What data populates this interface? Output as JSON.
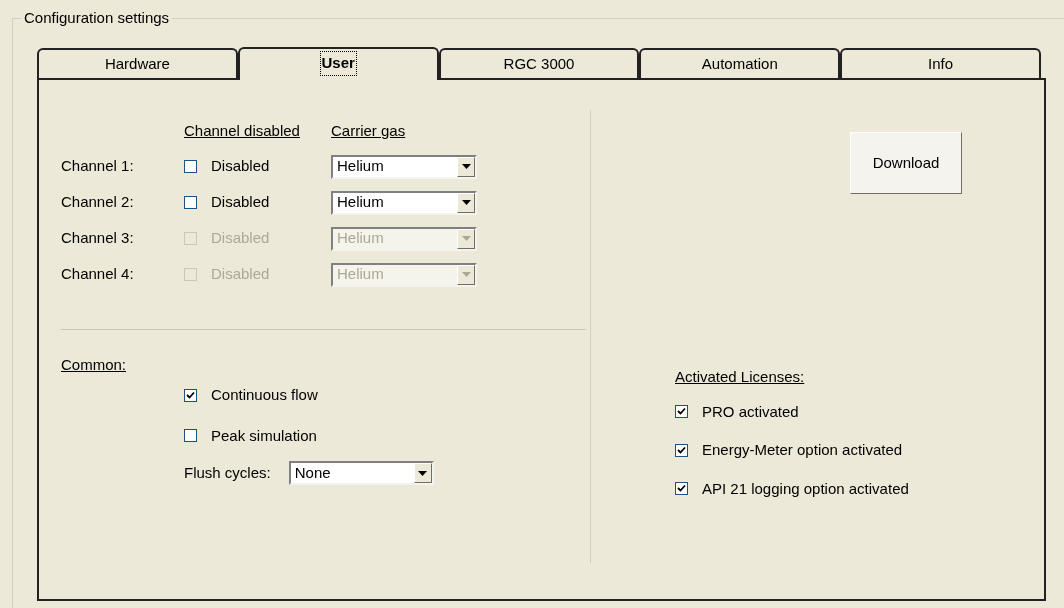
{
  "group_title": "Configuration settings",
  "tabs": [
    {
      "label": "Hardware",
      "selected": false
    },
    {
      "label": "User",
      "selected": true
    },
    {
      "label": "RGC 3000",
      "selected": false
    },
    {
      "label": "Automation",
      "selected": false
    },
    {
      "label": "Info",
      "selected": false
    }
  ],
  "channel_headers": {
    "disabled": "Channel disabled",
    "carrier": "Carrier gas"
  },
  "channels": [
    {
      "label": "Channel 1:",
      "checkbox": "Disabled",
      "checked": false,
      "disabled": false,
      "carrier": "Helium"
    },
    {
      "label": "Channel 2:",
      "checkbox": "Disabled",
      "checked": false,
      "disabled": false,
      "carrier": "Helium"
    },
    {
      "label": "Channel 3:",
      "checkbox": "Disabled",
      "checked": false,
      "disabled": true,
      "carrier": "Helium"
    },
    {
      "label": "Channel 4:",
      "checkbox": "Disabled",
      "checked": false,
      "disabled": true,
      "carrier": "Helium"
    }
  ],
  "common": {
    "title": "Common:",
    "options": [
      {
        "label": "Continuous flow",
        "checked": true
      },
      {
        "label": "Peak simulation",
        "checked": false
      }
    ],
    "flush_label": "Flush cycles:",
    "flush_value": "None"
  },
  "download_button": "Download",
  "licenses": {
    "title": "Activated Licenses:",
    "items": [
      {
        "label": "PRO activated",
        "checked": true
      },
      {
        "label": "Energy-Meter option activated",
        "checked": true
      },
      {
        "label": "API 21 logging option activated",
        "checked": true
      }
    ]
  }
}
